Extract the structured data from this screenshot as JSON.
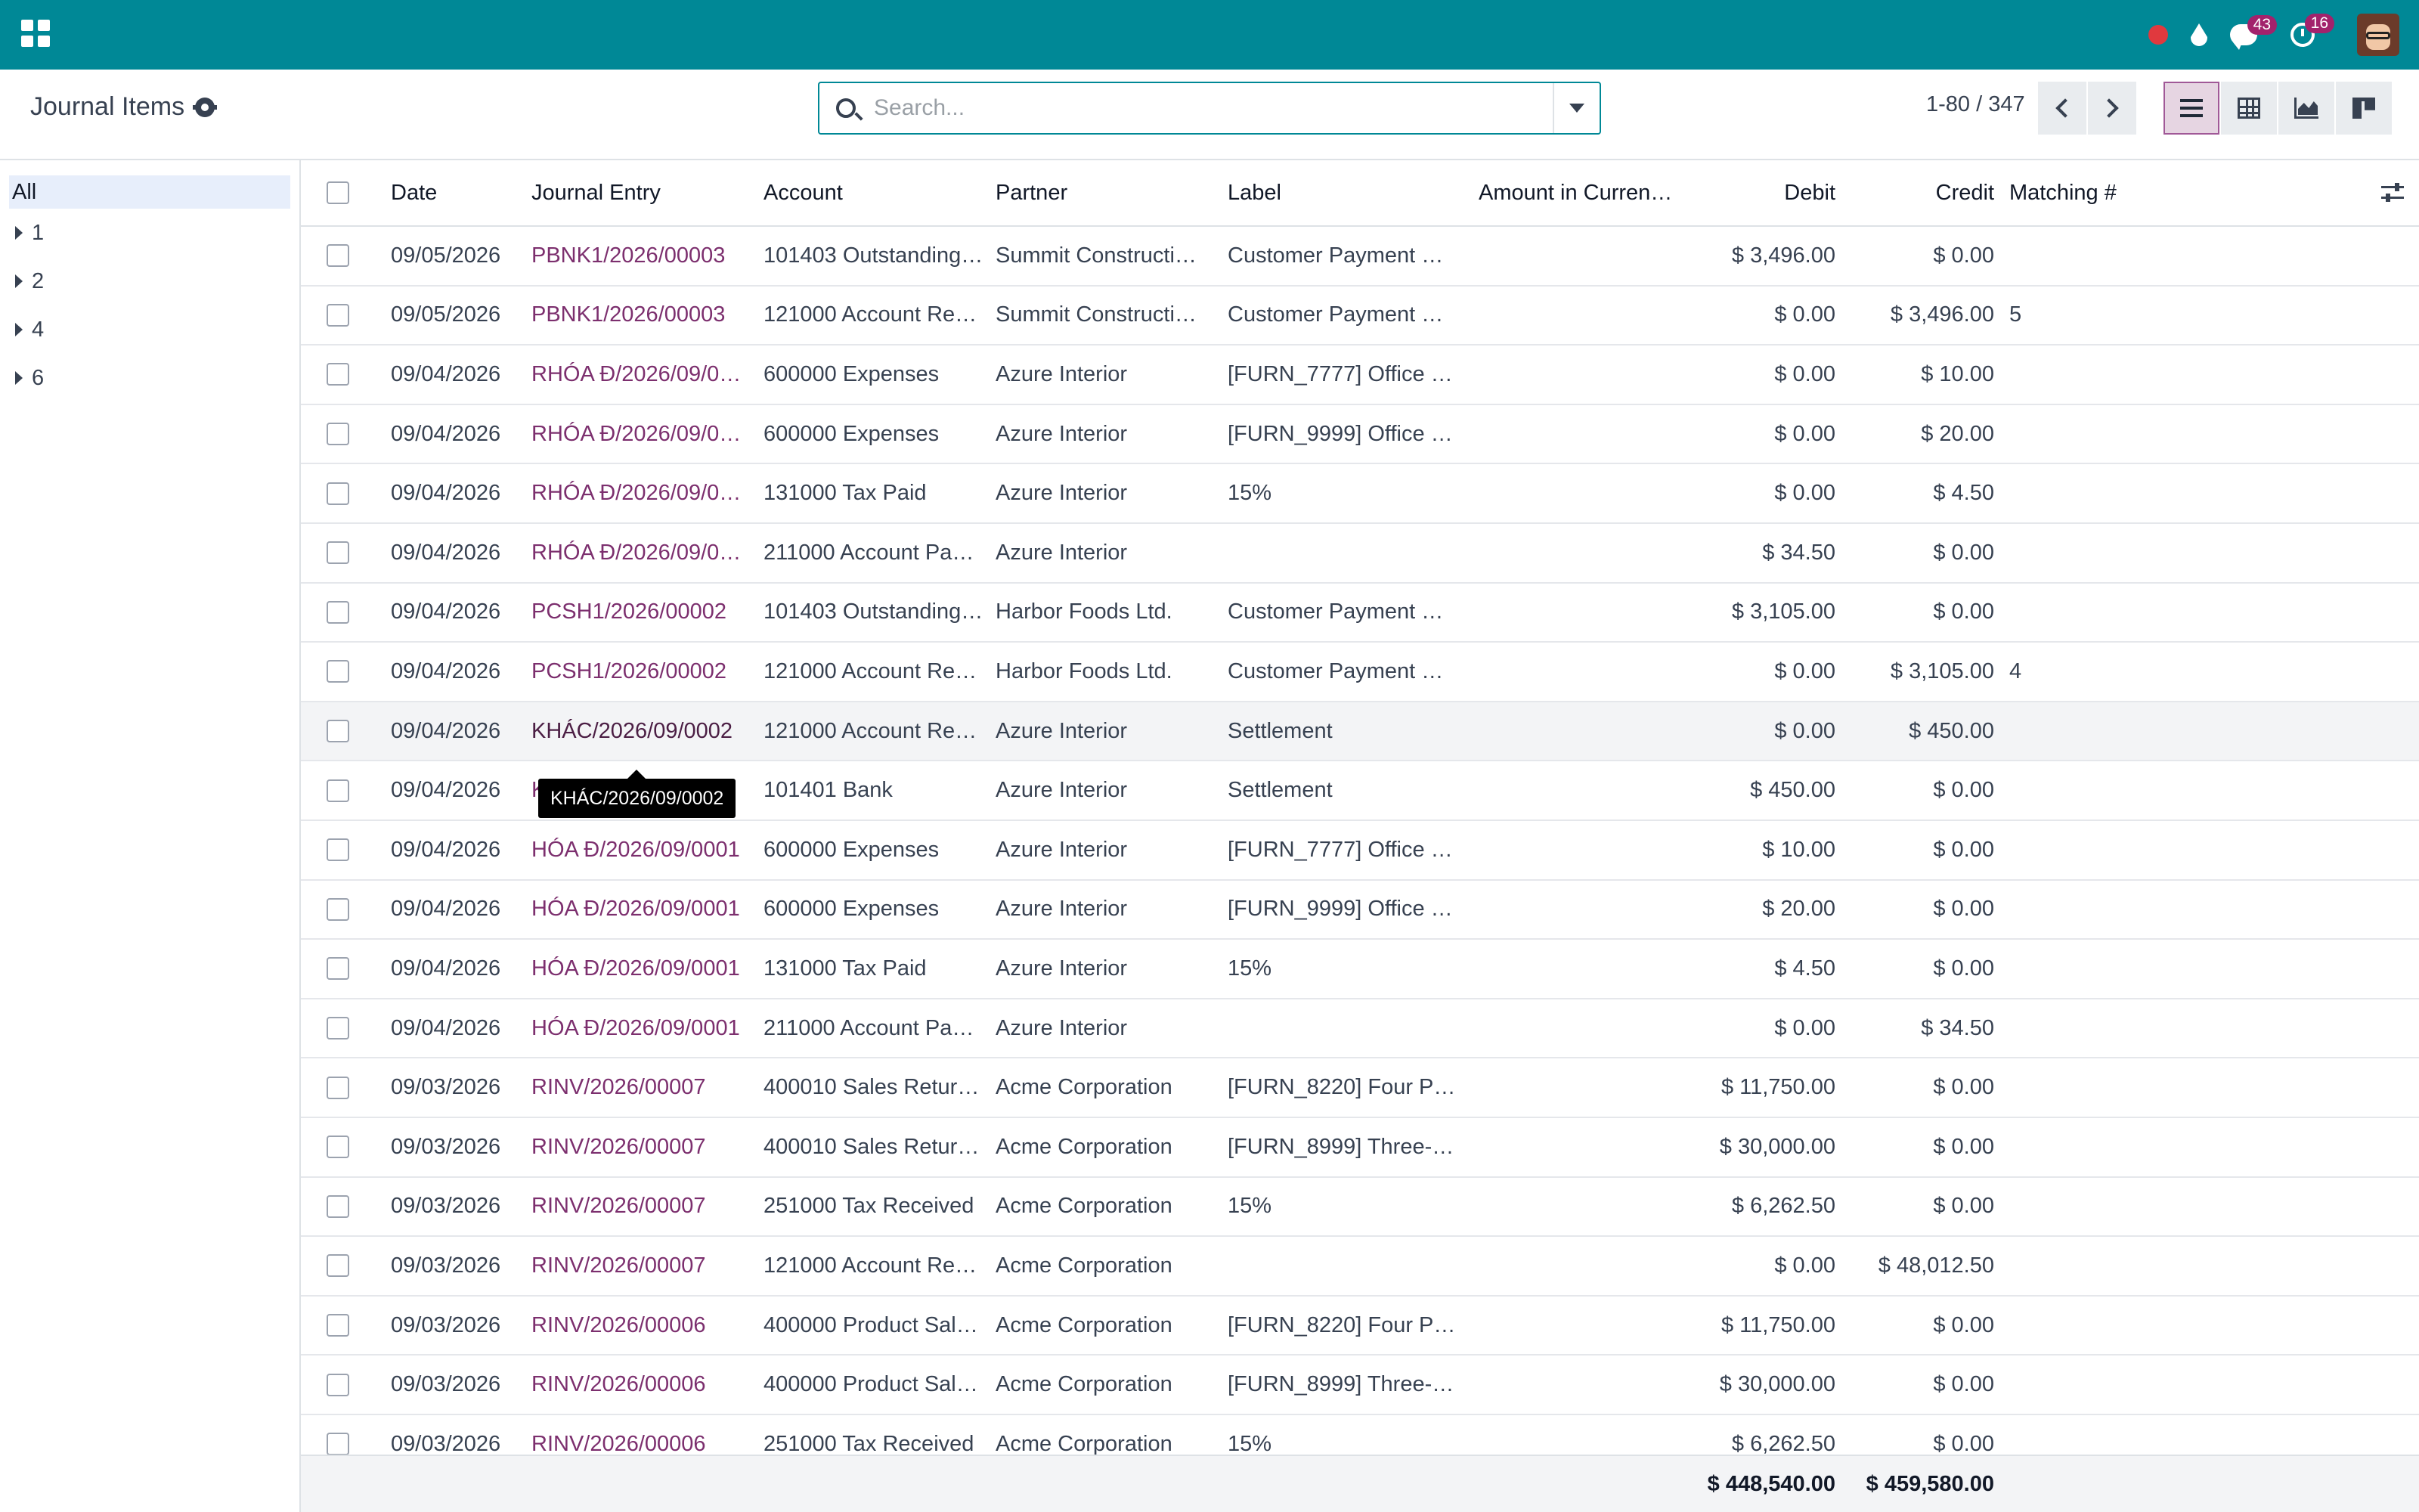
{
  "navbar": {
    "messages_count": "43",
    "activities_count": "16"
  },
  "control_panel": {
    "title": "Journal Items",
    "search_placeholder": "Search...",
    "pager": "1-80 / 347"
  },
  "sidebar": {
    "items": [
      {
        "label": "All",
        "expandable": false
      },
      {
        "label": "1",
        "expandable": true
      },
      {
        "label": "2",
        "expandable": true
      },
      {
        "label": "4",
        "expandable": true
      },
      {
        "label": "6",
        "expandable": true
      }
    ]
  },
  "table": {
    "columns": {
      "date": "Date",
      "journal_entry": "Journal Entry",
      "account": "Account",
      "partner": "Partner",
      "label": "Label",
      "amount_currency": "Amount in Curren…",
      "debit": "Debit",
      "credit": "Credit",
      "matching": "Matching #"
    },
    "rows": [
      {
        "date": "09/05/2026",
        "entry": "PBNK1/2026/00003",
        "account": "101403 Outstanding…",
        "partner": "Summit Constructi…",
        "label": "Customer Payment …",
        "debit": "$ 3,496.00",
        "credit": "$ 0.00",
        "matching": ""
      },
      {
        "date": "09/05/2026",
        "entry": "PBNK1/2026/00003",
        "account": "121000 Account Re…",
        "partner": "Summit Constructi…",
        "label": "Customer Payment …",
        "debit": "$ 0.00",
        "credit": "$ 3,496.00",
        "matching": "5"
      },
      {
        "date": "09/04/2026",
        "entry": "RHÓA Đ/2026/09/0…",
        "account": "600000 Expenses",
        "partner": "Azure Interior",
        "label": "[FURN_7777] Office …",
        "debit": "$ 0.00",
        "credit": "$ 10.00",
        "matching": ""
      },
      {
        "date": "09/04/2026",
        "entry": "RHÓA Đ/2026/09/0…",
        "account": "600000 Expenses",
        "partner": "Azure Interior",
        "label": "[FURN_9999] Office …",
        "debit": "$ 0.00",
        "credit": "$ 20.00",
        "matching": ""
      },
      {
        "date": "09/04/2026",
        "entry": "RHÓA Đ/2026/09/0…",
        "account": "131000 Tax Paid",
        "partner": "Azure Interior",
        "label": "15%",
        "debit": "$ 0.00",
        "credit": "$ 4.50",
        "matching": ""
      },
      {
        "date": "09/04/2026",
        "entry": "RHÓA Đ/2026/09/0…",
        "account": "211000 Account Pa…",
        "partner": "Azure Interior",
        "label": "",
        "debit": "$ 34.50",
        "credit": "$ 0.00",
        "matching": ""
      },
      {
        "date": "09/04/2026",
        "entry": "PCSH1/2026/00002",
        "account": "101403 Outstanding…",
        "partner": "Harbor Foods Ltd.",
        "label": "Customer Payment …",
        "debit": "$ 3,105.00",
        "credit": "$ 0.00",
        "matching": ""
      },
      {
        "date": "09/04/2026",
        "entry": "PCSH1/2026/00002",
        "account": "121000 Account Re…",
        "partner": "Harbor Foods Ltd.",
        "label": "Customer Payment …",
        "debit": "$ 0.00",
        "credit": "$ 3,105.00",
        "matching": "4"
      },
      {
        "date": "09/04/2026",
        "entry": "KHÁC/2026/09/0002",
        "account": "121000 Account Re…",
        "partner": "Azure Interior",
        "label": "Settlement",
        "debit": "$ 0.00",
        "credit": "$ 450.00",
        "matching": ""
      },
      {
        "date": "09/04/2026",
        "entry": "K",
        "account": "101401 Bank",
        "partner": "Azure Interior",
        "label": "Settlement",
        "debit": "$ 450.00",
        "credit": "$ 0.00",
        "matching": ""
      },
      {
        "date": "09/04/2026",
        "entry": "HÓA Đ/2026/09/0001",
        "account": "600000 Expenses",
        "partner": "Azure Interior",
        "label": "[FURN_7777] Office …",
        "debit": "$ 10.00",
        "credit": "$ 0.00",
        "matching": ""
      },
      {
        "date": "09/04/2026",
        "entry": "HÓA Đ/2026/09/0001",
        "account": "600000 Expenses",
        "partner": "Azure Interior",
        "label": "[FURN_9999] Office …",
        "debit": "$ 20.00",
        "credit": "$ 0.00",
        "matching": ""
      },
      {
        "date": "09/04/2026",
        "entry": "HÓA Đ/2026/09/0001",
        "account": "131000 Tax Paid",
        "partner": "Azure Interior",
        "label": "15%",
        "debit": "$ 4.50",
        "credit": "$ 0.00",
        "matching": ""
      },
      {
        "date": "09/04/2026",
        "entry": "HÓA Đ/2026/09/0001",
        "account": "211000 Account Pa…",
        "partner": "Azure Interior",
        "label": "",
        "debit": "$ 0.00",
        "credit": "$ 34.50",
        "matching": ""
      },
      {
        "date": "09/03/2026",
        "entry": "RINV/2026/00007",
        "account": "400010 Sales Retur…",
        "partner": "Acme Corporation",
        "label": "[FURN_8220] Four P…",
        "debit": "$ 11,750.00",
        "credit": "$ 0.00",
        "matching": ""
      },
      {
        "date": "09/03/2026",
        "entry": "RINV/2026/00007",
        "account": "400010 Sales Retur…",
        "partner": "Acme Corporation",
        "label": "[FURN_8999] Three-…",
        "debit": "$ 30,000.00",
        "credit": "$ 0.00",
        "matching": ""
      },
      {
        "date": "09/03/2026",
        "entry": "RINV/2026/00007",
        "account": "251000 Tax Received",
        "partner": "Acme Corporation",
        "label": "15%",
        "debit": "$ 6,262.50",
        "credit": "$ 0.00",
        "matching": ""
      },
      {
        "date": "09/03/2026",
        "entry": "RINV/2026/00007",
        "account": "121000 Account Re…",
        "partner": "Acme Corporation",
        "label": "",
        "debit": "$ 0.00",
        "credit": "$ 48,012.50",
        "matching": ""
      },
      {
        "date": "09/03/2026",
        "entry": "RINV/2026/00006",
        "account": "400000 Product Sal…",
        "partner": "Acme Corporation",
        "label": "[FURN_8220] Four P…",
        "debit": "$ 11,750.00",
        "credit": "$ 0.00",
        "matching": ""
      },
      {
        "date": "09/03/2026",
        "entry": "RINV/2026/00006",
        "account": "400000 Product Sal…",
        "partner": "Acme Corporation",
        "label": "[FURN_8999] Three-…",
        "debit": "$ 30,000.00",
        "credit": "$ 0.00",
        "matching": ""
      },
      {
        "date": "09/03/2026",
        "entry": "RINV/2026/00006",
        "account": "251000 Tax Received",
        "partner": "Acme Corporation",
        "label": "15%",
        "debit": "$ 6,262.50",
        "credit": "$ 0.00",
        "matching": ""
      }
    ],
    "totals": {
      "debit": "$ 448,540.00",
      "credit": "$ 459,580.00"
    }
  },
  "tooltip": {
    "text": "KHÁC/2026/09/0002"
  },
  "colors": {
    "navbar": "#008896",
    "link": "#7c2f6e",
    "badge": "#a2226c"
  }
}
